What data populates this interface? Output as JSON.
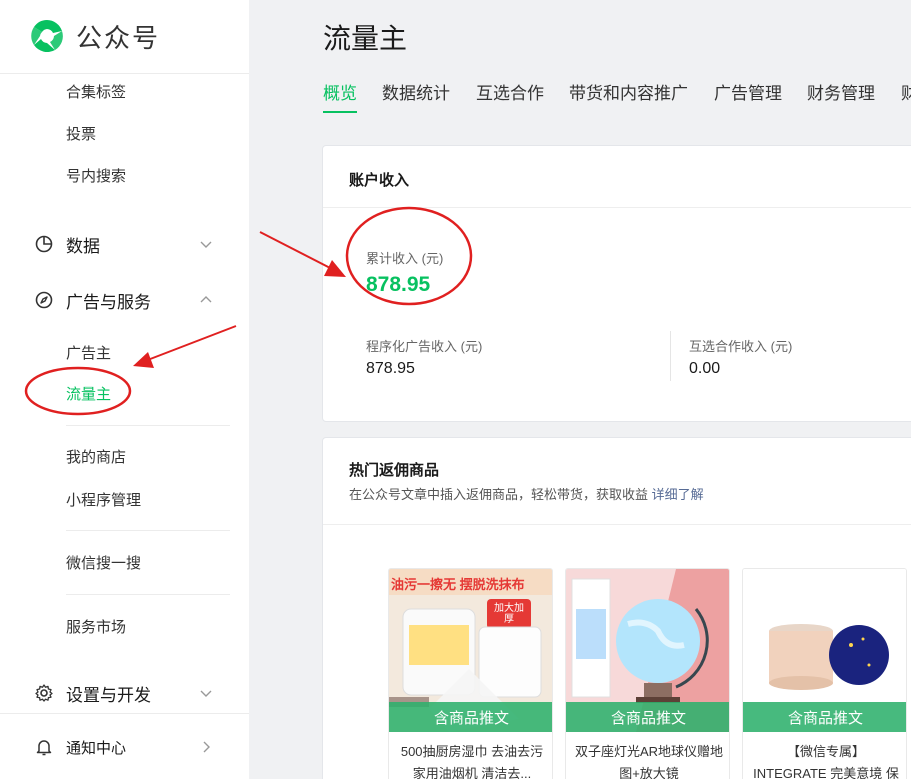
{
  "app": {
    "name": "公众号",
    "accent": "#07c160"
  },
  "sidebar": {
    "top_subitems": [
      "合集标签",
      "投票",
      "号内搜索"
    ],
    "data_group": {
      "label": "数据",
      "icon": "pie-chart-icon",
      "state": "collapsed"
    },
    "ads_group": {
      "label": "广告与服务",
      "icon": "compass-icon",
      "state": "expanded"
    },
    "ads_subitems": [
      "广告主",
      "流量主"
    ],
    "active_item": "流量主",
    "more_items": [
      "我的商店",
      "小程序管理",
      "微信搜一搜",
      "服务市场"
    ],
    "settings_group": {
      "label": "设置与开发",
      "icon": "gear-icon",
      "state": "collapsed"
    },
    "notify_group": {
      "label": "通知中心",
      "icon": "bell-icon"
    }
  },
  "page": {
    "title": "流量主",
    "tabs": [
      "概览",
      "数据统计",
      "互选合作",
      "带货和内容推广",
      "广告管理",
      "财务管理",
      "财"
    ],
    "active_tab": "概览"
  },
  "income": {
    "title": "账户收入",
    "total_label": "累计收入 (元)",
    "total_value": "878.95",
    "programmatic_label": "程序化广告收入 (元)",
    "programmatic_value": "878.95",
    "mutual_label": "互选合作收入 (元)",
    "mutual_value": "0.00"
  },
  "hot": {
    "title": "热门返佣商品",
    "desc": "在公众号文章中插入返佣商品，轻松带货，获取收益",
    "link": "详细了解",
    "products": [
      {
        "badge": "含商品推文",
        "title": "500抽厨房湿巾 去油去污 家用油烟机 清洁去...",
        "img_text": "油污一擦无 摆脱洗抹布",
        "img_tag": "加大加厚"
      },
      {
        "badge": "含商品推文",
        "title": "双子座灯光AR地球仪赠地图+放大镜",
        "img_text": "",
        "img_tag": ""
      },
      {
        "badge": "含商品推文",
        "title": "【微信专属】INTEGRATE 完美意境 保湿粉底...",
        "img_text": "",
        "img_tag": ""
      }
    ]
  }
}
